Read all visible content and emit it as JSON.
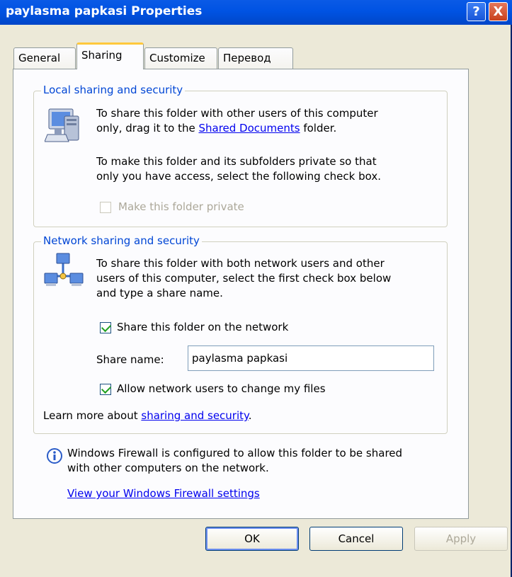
{
  "window": {
    "title": "paylasma papkasi Properties",
    "help_label": "?",
    "close_label": "X"
  },
  "tabs": [
    {
      "label": "General"
    },
    {
      "label": "Sharing"
    },
    {
      "label": "Customize"
    },
    {
      "label": "Перевод"
    }
  ],
  "local": {
    "legend": "Local sharing and security",
    "text1_pre": "To share this folder with other users of this computer",
    "text1_line2_pre": "only, drag it to the ",
    "text1_link": "Shared Documents",
    "text1_post": " folder.",
    "text2_line1": "To make this folder and its subfolders private so that",
    "text2_line2": "only you have access, select the following check box.",
    "private_label": "Make this folder private"
  },
  "network": {
    "legend": "Network sharing and security",
    "text_line1": "To share this folder with both network users and other",
    "text_line2": "users of this computer, select the first check box below",
    "text_line3": "and type a share name.",
    "share_label": "Share this folder on the network",
    "share_name_label": "Share name:",
    "share_name_value": "paylasma papkasi",
    "allow_label": "Allow network users to change my files",
    "learn_pre": "Learn more about ",
    "learn_link": "sharing and security",
    "learn_post": "."
  },
  "firewall": {
    "line1": "Windows Firewall is configured to allow this folder to be shared",
    "line2": "with other computers on the network.",
    "link": "View your Windows Firewall settings"
  },
  "buttons": {
    "ok": "OK",
    "cancel": "Cancel",
    "apply": "Apply"
  }
}
